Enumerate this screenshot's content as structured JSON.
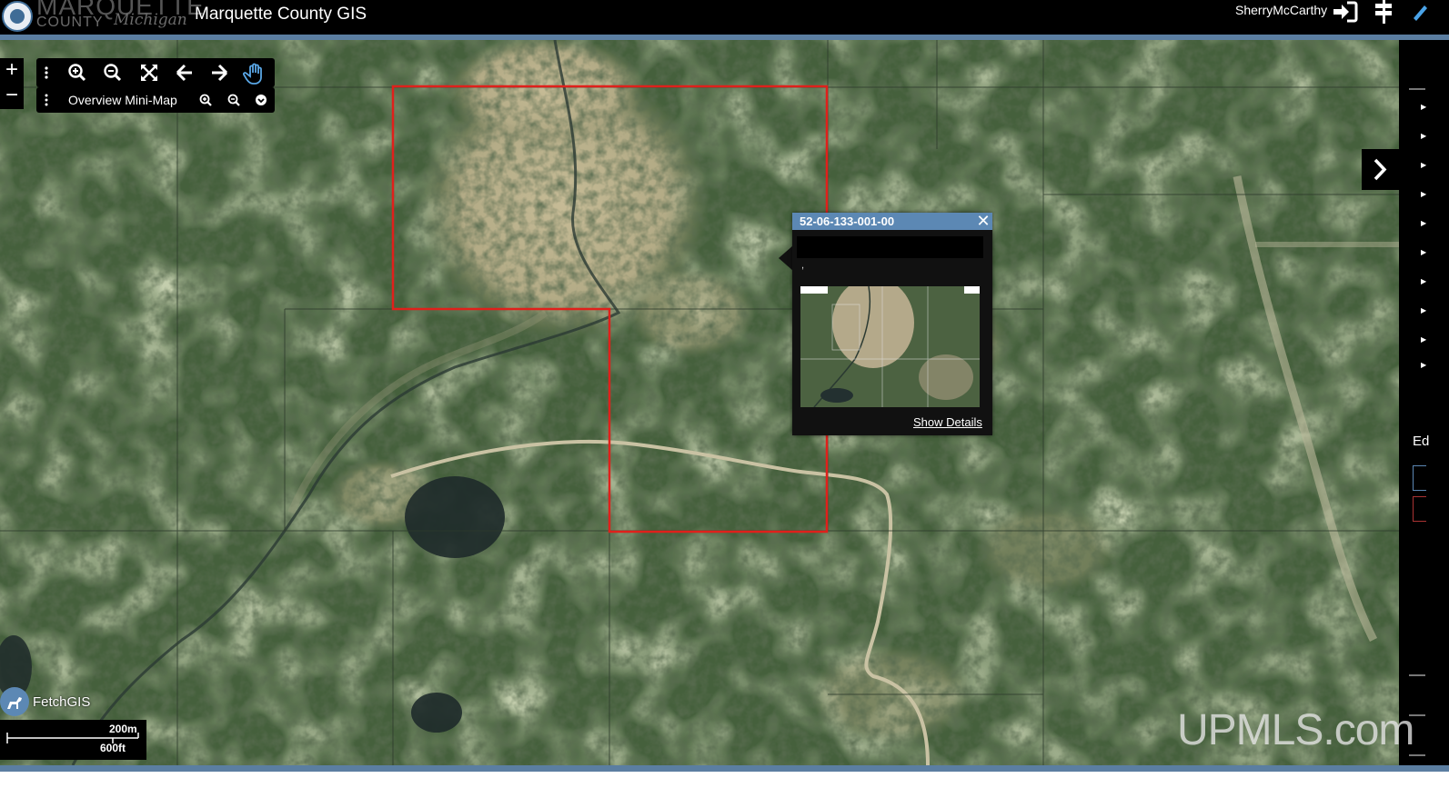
{
  "header": {
    "logo_wordmark": "MARQUETTE",
    "logo_county": "COUNTY",
    "logo_state": "Michigan",
    "app_title": "Marquette County GIS",
    "username": "SherryMcCarthy",
    "login_icon": "sign-in-icon",
    "tools_icon": "signpost-icon"
  },
  "map_controls": {
    "zoom_in": "+",
    "zoom_out": "−",
    "toolbar_icons": [
      "menu-grip-icon",
      "zoom-in-icon",
      "zoom-out-icon",
      "full-extent-icon",
      "back-arrow-icon",
      "forward-arrow-icon",
      "pan-hand-icon"
    ],
    "minimap_label": "Overview Mini-Map",
    "minimap_icons": [
      "menu-grip-icon",
      "zoom-in-icon",
      "zoom-out-icon",
      "chevron-down-icon"
    ]
  },
  "popup": {
    "title": "52-06-133-001-00",
    "close_glyph": "✕",
    "small_text": ",",
    "show_details_label": "Show Details"
  },
  "right_panel": {
    "partial_text": "Ed",
    "expand_icon": "chevron-right-icon"
  },
  "branding": {
    "fetchgis_label": "FetchGIS",
    "watermark": "UPMLS.com"
  },
  "scale": {
    "metric": "200m",
    "imperial": "600ft"
  },
  "colors": {
    "header_bg": "#000000",
    "header_band": "#5b7ea1",
    "popup_header": "#5c88b4",
    "parcel_outline": "#e0201b",
    "pan_active": "#5aa7e6"
  }
}
